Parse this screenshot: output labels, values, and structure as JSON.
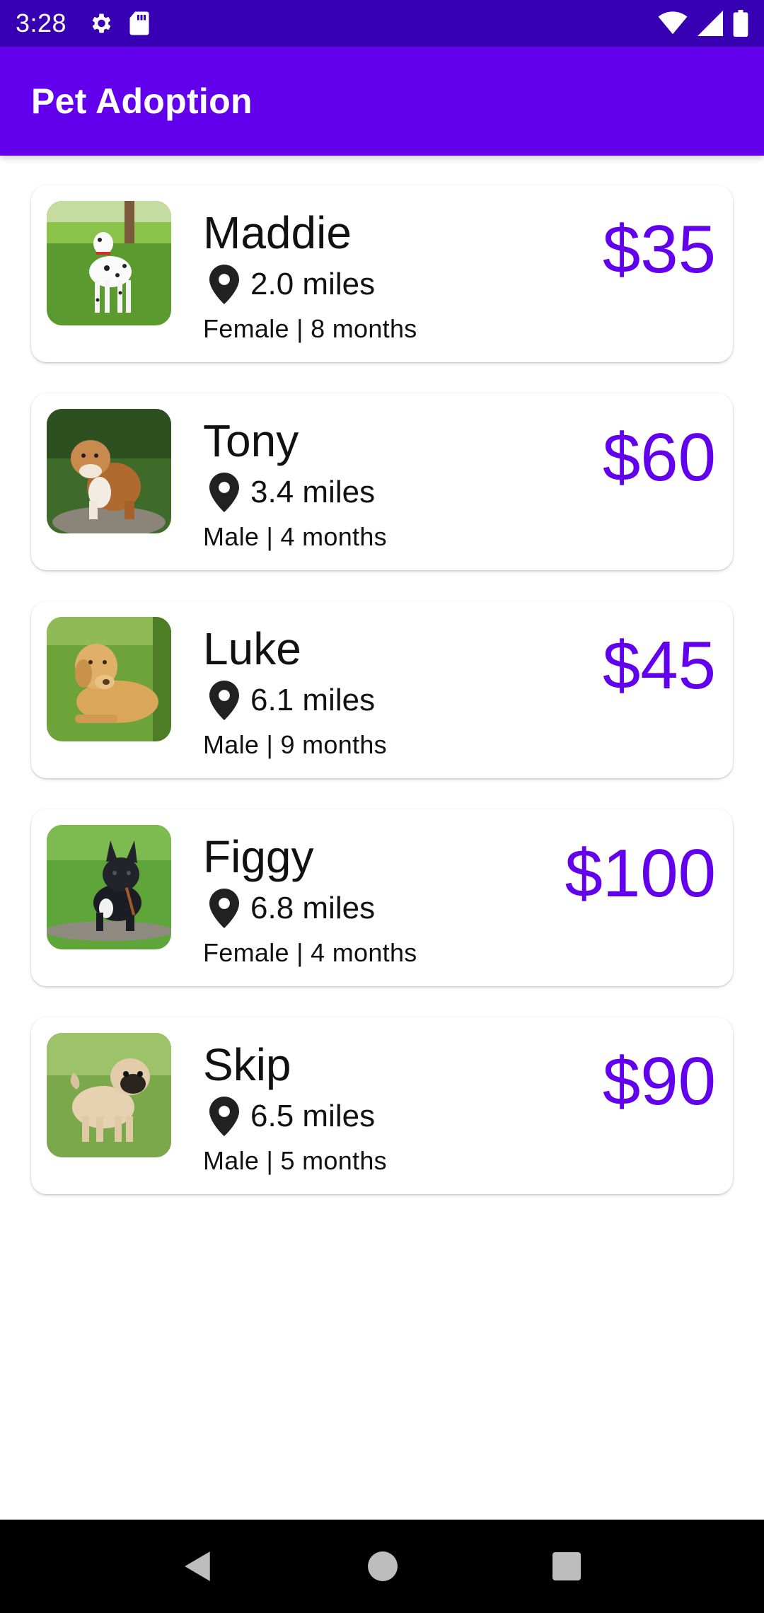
{
  "status_bar": {
    "time": "3:28",
    "icons": [
      "gear-icon",
      "sd-card-icon",
      "wifi-icon",
      "signal-icon",
      "battery-icon"
    ]
  },
  "app_bar": {
    "title": "Pet Adoption"
  },
  "colors": {
    "status_bar": "#3700b3",
    "app_bar": "#6200ee",
    "price": "#6200ee",
    "nav_bar": "#000000"
  },
  "pets": [
    {
      "name": "Maddie",
      "distance": "2.0 miles",
      "details": "Female | 8 months",
      "price": "$35",
      "photo": "dalmatian"
    },
    {
      "name": "Tony",
      "distance": "3.4 miles",
      "details": "Male | 4 months",
      "price": "$60",
      "photo": "bulldog"
    },
    {
      "name": "Luke",
      "distance": "6.1 miles",
      "details": "Male | 9 months",
      "price": "$45",
      "photo": "labrador"
    },
    {
      "name": "Figgy",
      "distance": "6.8 miles",
      "details": "Female | 4 months",
      "price": "$100",
      "photo": "french-bulldog"
    },
    {
      "name": "Skip",
      "distance": "6.5 miles",
      "details": "Male | 5 months",
      "price": "$90",
      "photo": "pug"
    }
  ],
  "nav_bar": {
    "icons": [
      "back-icon",
      "home-icon",
      "recents-icon"
    ]
  }
}
